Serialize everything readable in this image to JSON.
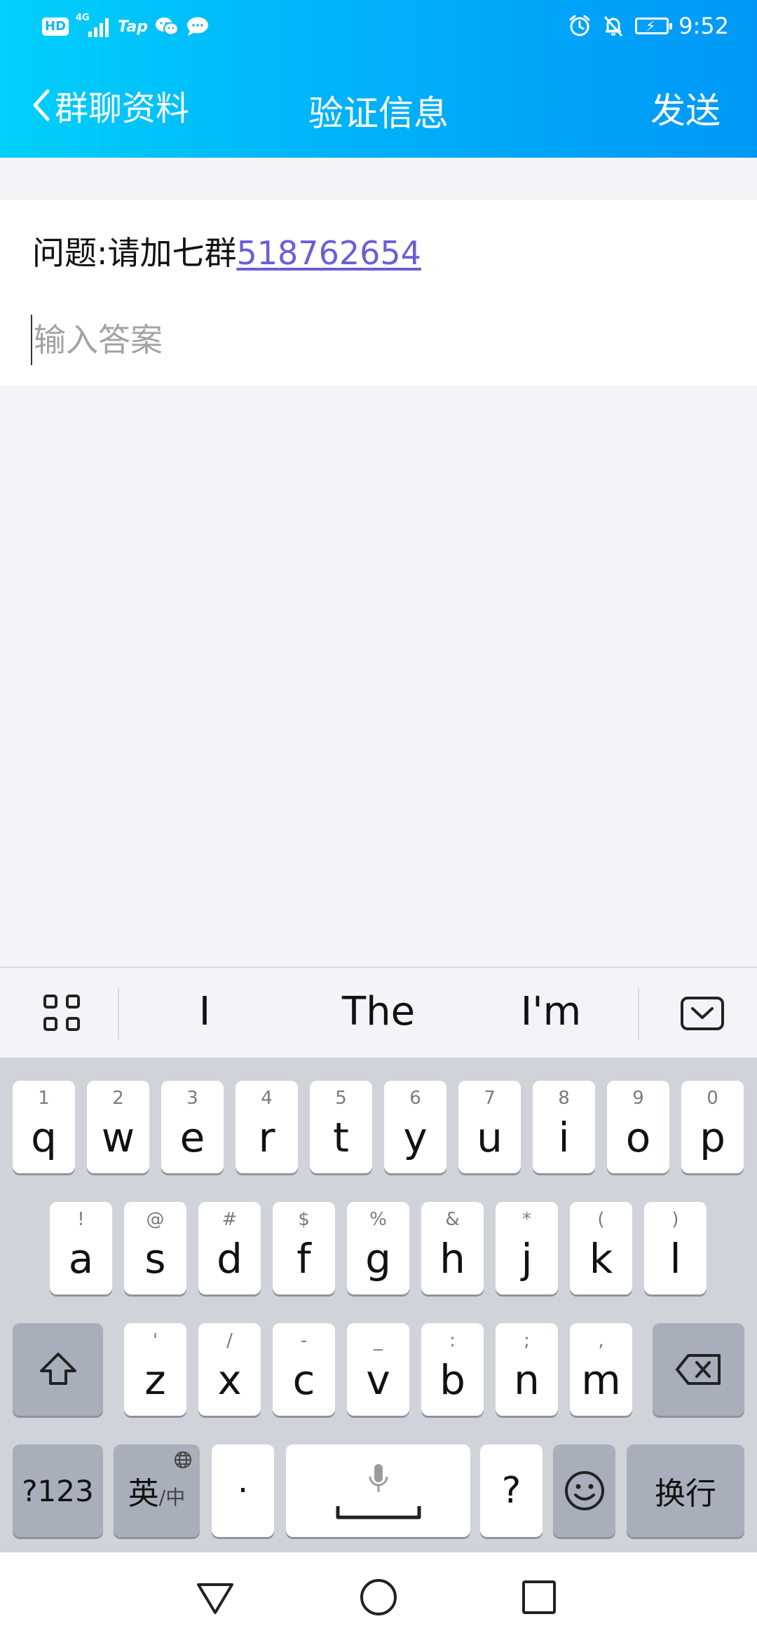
{
  "status_bar": {
    "hd_badge": "HD",
    "network": "4G",
    "tap_label": "Tap",
    "time": "9:52"
  },
  "header": {
    "back_label": "群聊资料",
    "title": "验证信息",
    "send_label": "发送",
    "gradient_colors": [
      "#00d0fb",
      "#0098f7"
    ]
  },
  "form": {
    "question_prefix": "问题:请加七群",
    "question_number": "518762654",
    "answer_value": "",
    "answer_placeholder": "输入答案"
  },
  "suggestions": {
    "words": [
      "I",
      "The",
      "I'm"
    ]
  },
  "keyboard": {
    "row1": [
      {
        "letter": "q",
        "hint": "1"
      },
      {
        "letter": "w",
        "hint": "2"
      },
      {
        "letter": "e",
        "hint": "3"
      },
      {
        "letter": "r",
        "hint": "4"
      },
      {
        "letter": "t",
        "hint": "5"
      },
      {
        "letter": "y",
        "hint": "6"
      },
      {
        "letter": "u",
        "hint": "7"
      },
      {
        "letter": "i",
        "hint": "8"
      },
      {
        "letter": "o",
        "hint": "9"
      },
      {
        "letter": "p",
        "hint": "0"
      }
    ],
    "row2": [
      {
        "letter": "a",
        "hint": "!"
      },
      {
        "letter": "s",
        "hint": "@"
      },
      {
        "letter": "d",
        "hint": "#"
      },
      {
        "letter": "f",
        "hint": "$"
      },
      {
        "letter": "g",
        "hint": "%"
      },
      {
        "letter": "h",
        "hint": "&"
      },
      {
        "letter": "j",
        "hint": "*"
      },
      {
        "letter": "k",
        "hint": "("
      },
      {
        "letter": "l",
        "hint": ")"
      }
    ],
    "row3": [
      {
        "letter": "z",
        "hint": "'"
      },
      {
        "letter": "x",
        "hint": "/"
      },
      {
        "letter": "c",
        "hint": "-"
      },
      {
        "letter": "v",
        "hint": "_"
      },
      {
        "letter": "b",
        "hint": ":"
      },
      {
        "letter": "n",
        "hint": ";"
      },
      {
        "letter": "m",
        "hint": ","
      }
    ],
    "symbols_label": "?123",
    "lang_label_main": "英",
    "lang_label_sub": "/中",
    "dot_label": "·",
    "question_label": "?",
    "enter_label": "换行",
    "key_color": "#ffffff",
    "function_key_color": "#a9aebb",
    "background_color": "#d1d3db"
  }
}
